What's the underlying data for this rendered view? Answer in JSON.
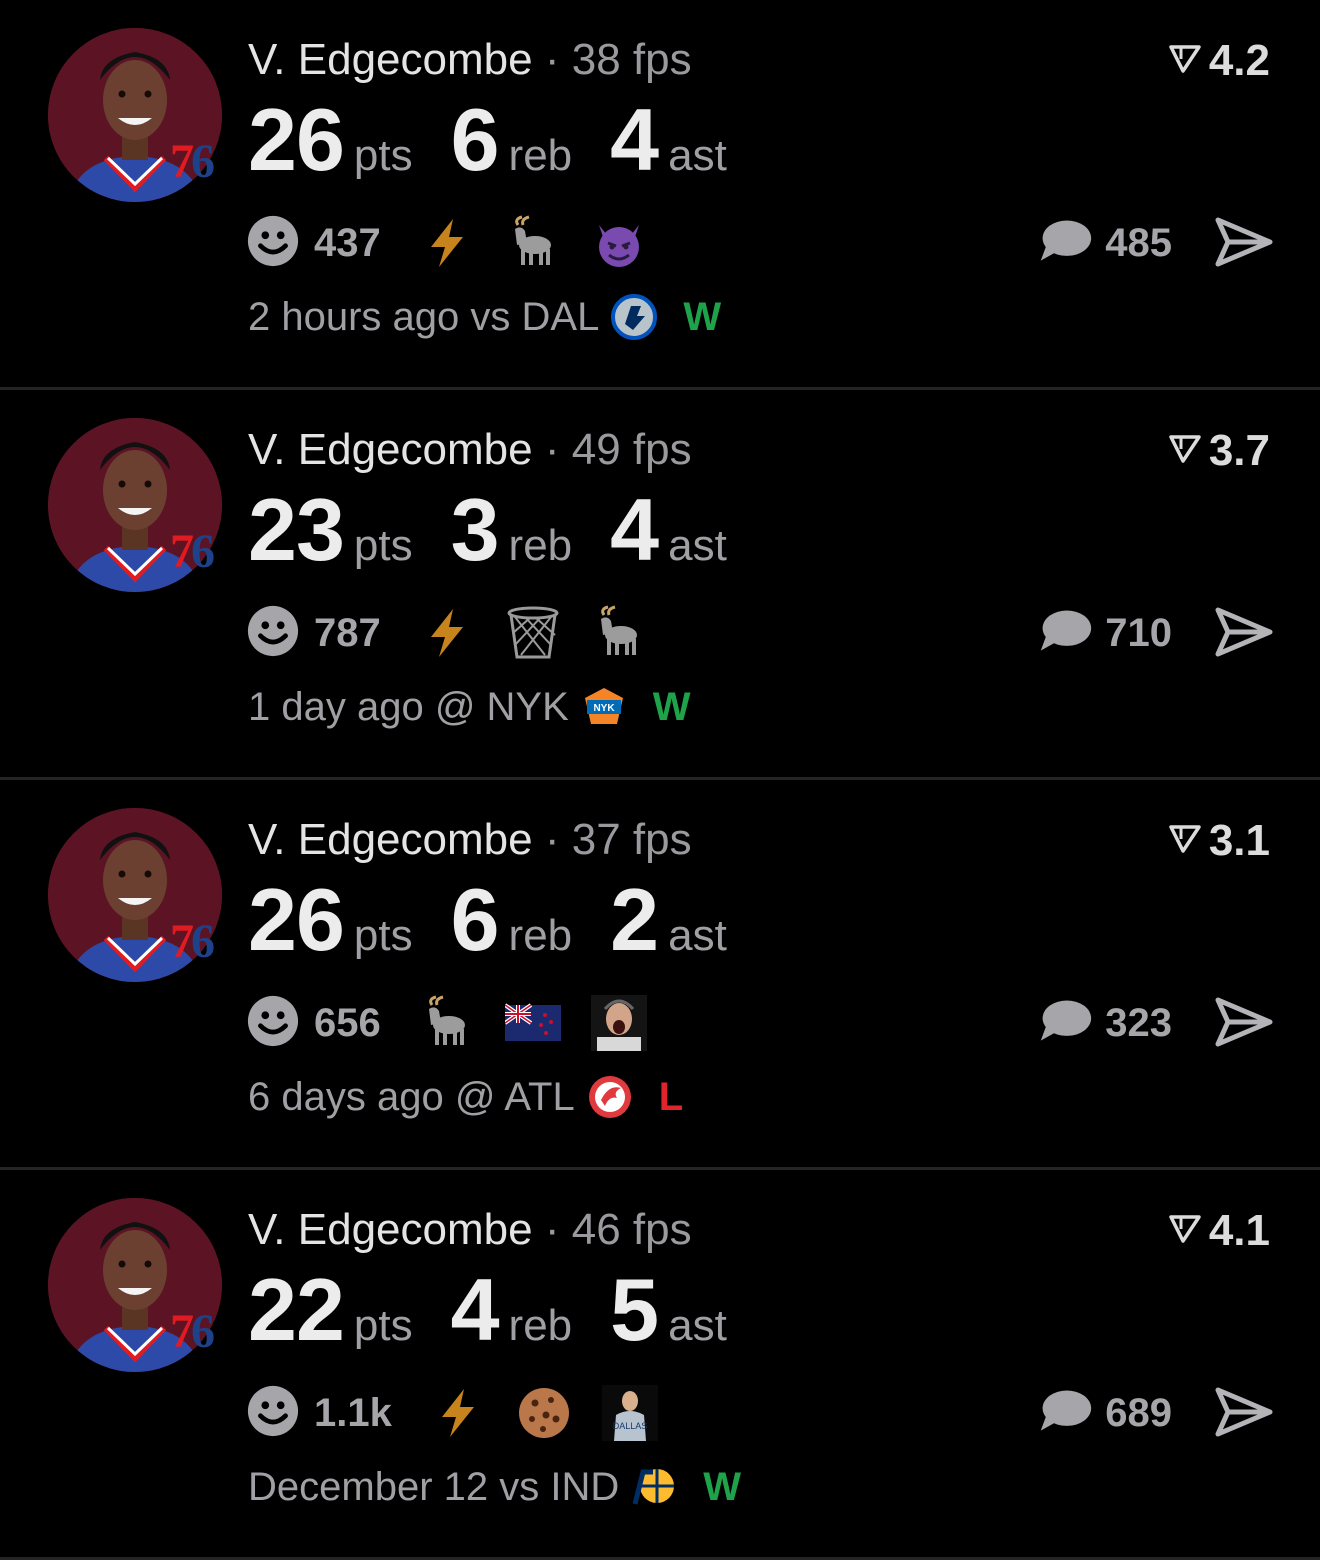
{
  "colors": {
    "background": "#000000",
    "win": "#1fa34a",
    "loss": "#e0242b",
    "avatar_bg": "#5c1424",
    "team_red": "#e11b22",
    "team_blue": "#1d428a"
  },
  "posts": [
    {
      "player": "V. Edgecombe",
      "separator": "·",
      "fps": "38 fps",
      "rating": "4.2",
      "team_badge": {
        "seven": "7",
        "six": "6"
      },
      "stats": [
        {
          "value": "26",
          "label": "pts"
        },
        {
          "value": "6",
          "label": "reb"
        },
        {
          "value": "4",
          "label": "ast"
        }
      ],
      "reaction_count": "437",
      "reactions": [
        "lightning-icon",
        "goat-icon",
        "devil-icon"
      ],
      "comment_count": "485",
      "time": "2 hours ago",
      "opponent": "vs DAL",
      "opponent_logo": "dal-logo-icon",
      "result": "W"
    },
    {
      "player": "V. Edgecombe",
      "separator": "·",
      "fps": "49 fps",
      "rating": "3.7",
      "team_badge": {
        "seven": "7",
        "six": "6"
      },
      "stats": [
        {
          "value": "23",
          "label": "pts"
        },
        {
          "value": "3",
          "label": "reb"
        },
        {
          "value": "4",
          "label": "ast"
        }
      ],
      "reaction_count": "787",
      "reactions": [
        "lightning-icon",
        "basketball-net-icon",
        "goat-icon"
      ],
      "comment_count": "710",
      "time": "1 day ago",
      "opponent": "@ NYK",
      "opponent_logo": "nyk-logo-icon",
      "result": "W"
    },
    {
      "player": "V. Edgecombe",
      "separator": "·",
      "fps": "37 fps",
      "rating": "3.1",
      "team_badge": {
        "seven": "7",
        "six": "6"
      },
      "stats": [
        {
          "value": "26",
          "label": "pts"
        },
        {
          "value": "6",
          "label": "reb"
        },
        {
          "value": "2",
          "label": "ast"
        }
      ],
      "reaction_count": "656",
      "reactions": [
        "goat-icon",
        "new-zealand-flag-icon",
        "screaming-announcer-icon"
      ],
      "comment_count": "323",
      "time": "6 days ago",
      "opponent": "@ ATL",
      "opponent_logo": "atl-logo-icon",
      "result": "L"
    },
    {
      "player": "V. Edgecombe",
      "separator": "·",
      "fps": "46 fps",
      "rating": "4.1",
      "team_badge": {
        "seven": "7",
        "six": "6"
      },
      "stats": [
        {
          "value": "22",
          "label": "pts"
        },
        {
          "value": "4",
          "label": "reb"
        },
        {
          "value": "5",
          "label": "ast"
        }
      ],
      "reaction_count": "1.1k",
      "reactions": [
        "lightning-icon",
        "cookie-icon",
        "player-sticker-icon"
      ],
      "comment_count": "689",
      "time": "December 12",
      "opponent": "vs IND",
      "opponent_logo": "ind-logo-icon",
      "result": "W"
    }
  ]
}
